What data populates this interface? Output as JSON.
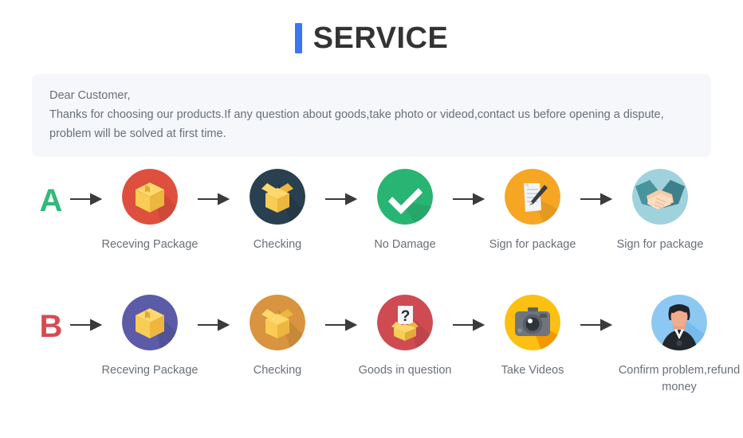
{
  "header": {
    "title": "SERVICE",
    "accent_color": "#3d74f0"
  },
  "notice": {
    "line1": "Dear Customer,",
    "line2": "Thanks for choosing our products.If any question about goods,take photo or videod,contact us before opening a dispute,",
    "line3": "problem will be solved at first time.",
    "background_color": "#f5f7fa",
    "text_color": "#6a6f78"
  },
  "flows": [
    {
      "badge": "A",
      "badge_color": "#30b97c",
      "steps": [
        {
          "label": "Receving Package",
          "icon": "closed-box-icon",
          "circle_color": "#df4f3e"
        },
        {
          "label": "Checking",
          "icon": "open-box-icon",
          "circle_color": "#28404f"
        },
        {
          "label": "No Damage",
          "icon": "check-mark-icon",
          "circle_color": "#28b473"
        },
        {
          "label": "Sign for package",
          "icon": "document-pen-icon",
          "circle_color": "#f6a623"
        },
        {
          "label": "Sign for package",
          "icon": "handshake-icon",
          "circle_color": "#9fd2dd"
        }
      ]
    },
    {
      "badge": "B",
      "badge_color": "#d94a52",
      "steps": [
        {
          "label": "Receving Package",
          "icon": "closed-box-icon",
          "circle_color": "#5b5ba8"
        },
        {
          "label": "Checking",
          "icon": "open-box-icon",
          "circle_color": "#d9943f"
        },
        {
          "label": "Goods in question",
          "icon": "question-box-icon",
          "circle_color": "#cf4b52"
        },
        {
          "label": "Take Videos",
          "icon": "camera-icon",
          "circle_color": "#fbc011"
        },
        {
          "label": "Confirm problem,refund money",
          "icon": "person-avatar-icon",
          "circle_color": "#8cc8f2"
        }
      ]
    }
  ],
  "arrow": {
    "icon": "arrow-right-icon",
    "color": "#3b3b3b"
  }
}
